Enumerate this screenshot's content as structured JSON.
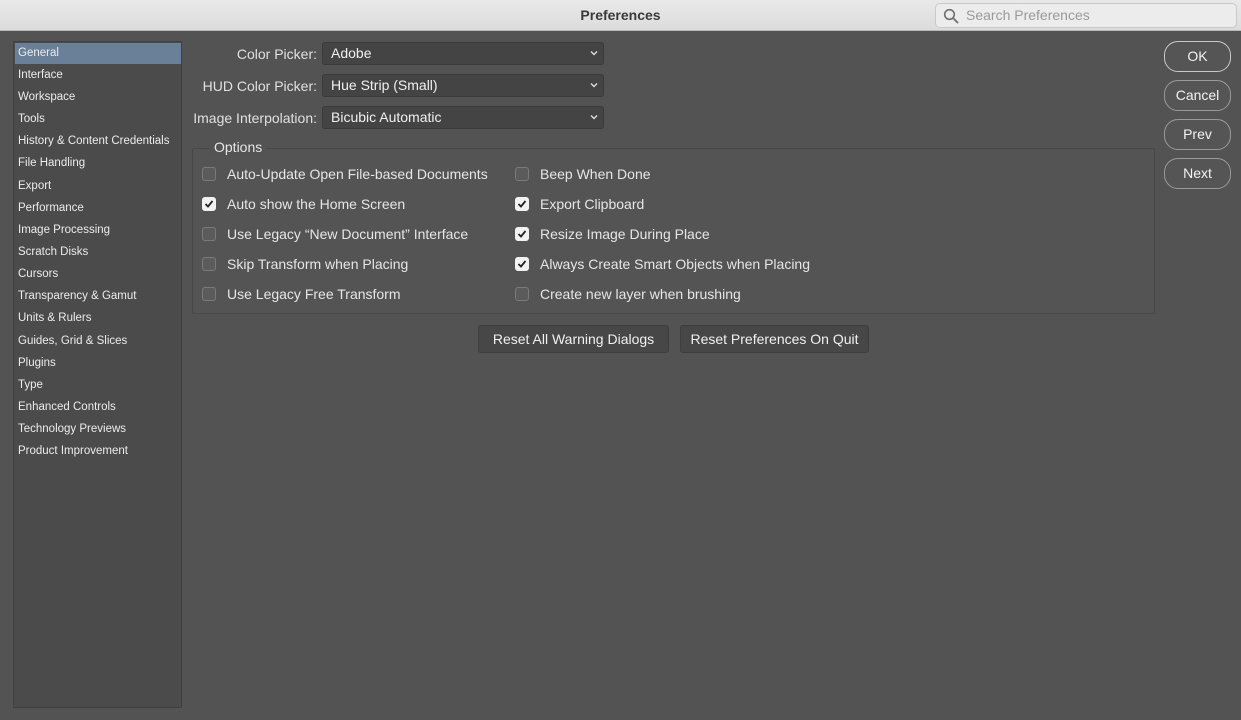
{
  "window": {
    "title": "Preferences"
  },
  "search": {
    "placeholder": "Search Preferences",
    "icon": "search-icon"
  },
  "sidebar": {
    "items": [
      {
        "label": "General",
        "selected": true
      },
      {
        "label": "Interface"
      },
      {
        "label": "Workspace"
      },
      {
        "label": "Tools"
      },
      {
        "label": "History & Content Credentials"
      },
      {
        "label": "File Handling"
      },
      {
        "label": "Export"
      },
      {
        "label": "Performance"
      },
      {
        "label": "Image Processing"
      },
      {
        "label": "Scratch Disks"
      },
      {
        "label": "Cursors"
      },
      {
        "label": "Transparency & Gamut"
      },
      {
        "label": "Units & Rulers"
      },
      {
        "label": "Guides, Grid & Slices"
      },
      {
        "label": "Plugins"
      },
      {
        "label": "Type"
      },
      {
        "label": "Enhanced Controls"
      },
      {
        "label": "Technology Previews"
      },
      {
        "label": "Product Improvement"
      }
    ]
  },
  "fields": {
    "color_picker": {
      "label": "Color Picker:",
      "value": "Adobe"
    },
    "hud_color_picker": {
      "label": "HUD Color Picker:",
      "value": "Hue Strip (Small)"
    },
    "image_interpolation": {
      "label": "Image Interpolation:",
      "value": "Bicubic Automatic"
    }
  },
  "options": {
    "label": "Options",
    "left": [
      {
        "label": "Auto-Update Open File-based Documents",
        "checked": false
      },
      {
        "label": "Auto show the Home Screen",
        "checked": true
      },
      {
        "label": "Use Legacy “New Document” Interface",
        "checked": false
      },
      {
        "label": "Skip Transform when Placing",
        "checked": false
      },
      {
        "label": "Use Legacy Free Transform",
        "checked": false
      }
    ],
    "right": [
      {
        "label": "Beep When Done",
        "checked": false
      },
      {
        "label": "Export Clipboard",
        "checked": true
      },
      {
        "label": "Resize Image During Place",
        "checked": true
      },
      {
        "label": "Always Create Smart Objects when Placing",
        "checked": true
      },
      {
        "label": "Create new layer when brushing",
        "checked": false
      }
    ]
  },
  "buttons": {
    "reset_warnings": "Reset All Warning Dialogs",
    "reset_prefs": "Reset Preferences On Quit",
    "ok": "OK",
    "cancel": "Cancel",
    "prev": "Prev",
    "next": "Next"
  }
}
